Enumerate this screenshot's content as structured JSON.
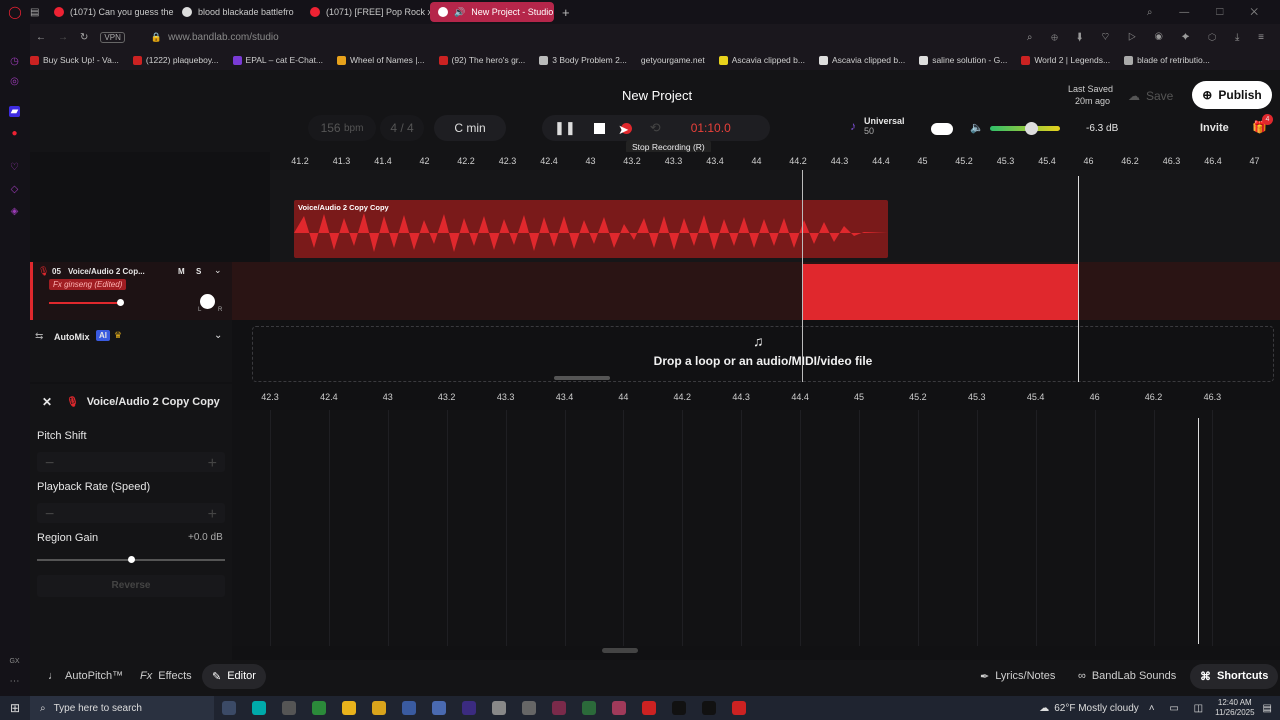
{
  "browser": {
    "tabs": [
      {
        "label": "(1071) Can you guess the",
        "active": false
      },
      {
        "label": "blood blackade battlefro",
        "active": false
      },
      {
        "label": "(1071) [FREE] Pop Rock x",
        "active": false
      },
      {
        "label": "New Project - Studio",
        "active": true
      }
    ],
    "url": "www.bandlab.com/studio",
    "vpn_label": "VPN",
    "bookmarks": [
      "Buy Suck Up! - Va...",
      "(1222) plaqueboy...",
      "EPAL – cat E-Chat...",
      "Wheel of Names |...",
      "(92) The hero's gr...",
      "3 Body Problem 2...",
      "getyourgame.net",
      "Ascavia clipped b...",
      "Ascavia clipped b...",
      "saline solution - G...",
      "World 2 | Legends...",
      "blade of retributio..."
    ]
  },
  "studio": {
    "project_title": "New Project",
    "last_saved_label": "Last Saved",
    "last_saved_time": "20m ago",
    "save_label": "Save",
    "publish_label": "Publish",
    "invite_label": "Invite",
    "gift_badge": "4",
    "bpm_value": "156",
    "bpm_unit": "bpm",
    "time_sig": "4 / 4",
    "key": "C min",
    "time_display": "01:10.0",
    "tooltip": "Stop Recording (R)",
    "universal_label": "Universal",
    "universal_value": "50",
    "master_db": "-6.3 dB",
    "master_volume": 0.6,
    "ruler_ticks": [
      "41.2",
      "41.3",
      "41.4",
      "42",
      "42.2",
      "42.3",
      "42.4",
      "43",
      "43.2",
      "43.3",
      "43.4",
      "44",
      "44.2",
      "44.3",
      "44.4",
      "45",
      "45.2",
      "45.3",
      "45.4",
      "46",
      "46.2",
      "46.3",
      "46.4",
      "47"
    ],
    "region_label": "Voice/Audio 2 Copy Copy",
    "track": {
      "number": "05",
      "name": "Voice/Audio 2 Cop...",
      "mute": "M",
      "solo": "S",
      "fx": "Fx ginseng (Edited)",
      "pan_left": "L",
      "pan_right": "R",
      "volume": 0.6
    },
    "automix_label": "AutoMix",
    "ai_badge": "AI",
    "drop_text": "Drop a loop or an audio/MIDI/video file",
    "colors": {
      "accent": "#e0282d",
      "publish_bg": "#ffffff",
      "timer": "#e8403a"
    }
  },
  "editor": {
    "region_name": "Voice/Audio 2 Copy Copy",
    "pitch_shift_label": "Pitch Shift",
    "playback_rate_label": "Playback Rate (Speed)",
    "region_gain_label": "Region Gain",
    "region_gain_value": "+0.0 dB",
    "region_gain_level": 0.5,
    "reverse_label": "Reverse",
    "minus": "−",
    "plus": "+",
    "ruler_ticks": [
      "42.3",
      "42.4",
      "43",
      "43.2",
      "43.3",
      "43.4",
      "44",
      "44.2",
      "44.3",
      "44.4",
      "45",
      "45.2",
      "45.3",
      "45.4",
      "46",
      "46.2",
      "46.3"
    ]
  },
  "bottom": {
    "autopitch": "AutoPitch™",
    "effects": "Effects",
    "editor": "Editor",
    "lyrics": "Lyrics/Notes",
    "sounds": "BandLab Sounds",
    "shortcuts": "Shortcuts"
  },
  "taskbar": {
    "search_placeholder": "Type here to search",
    "weather": "62°F  Mostly cloudy",
    "time": "12:40 AM",
    "date": "11/26/2025"
  }
}
